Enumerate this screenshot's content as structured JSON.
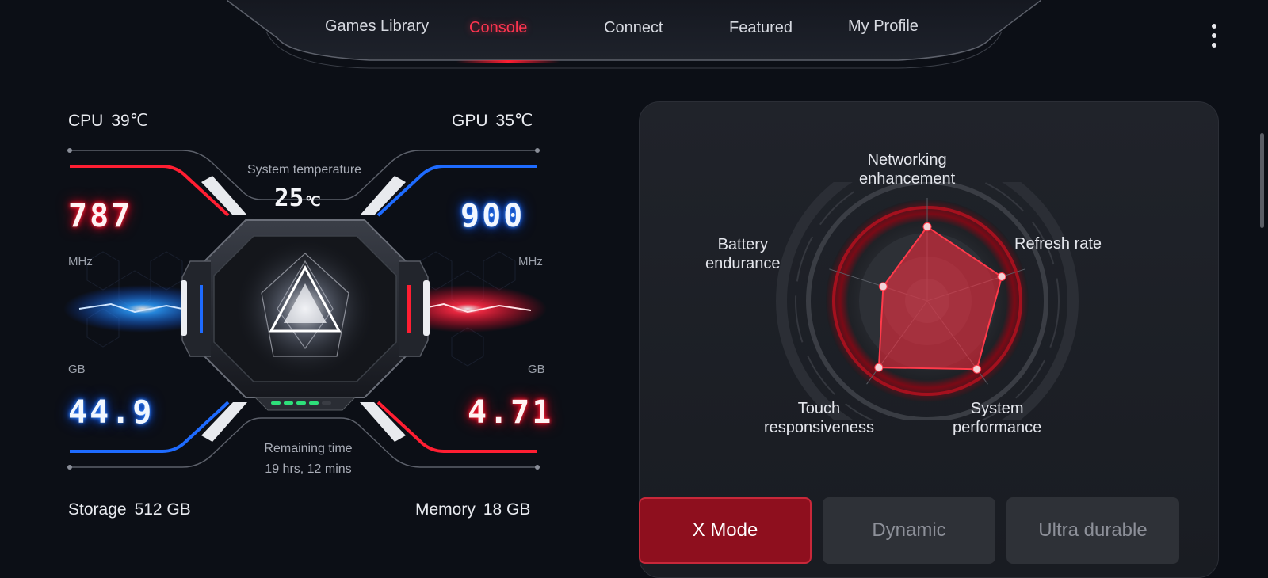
{
  "nav": {
    "tabs": [
      {
        "label": "Games Library",
        "active": false
      },
      {
        "label": "Console",
        "active": true
      },
      {
        "label": "Connect",
        "active": false
      },
      {
        "label": "Featured",
        "active": false
      },
      {
        "label": "My Profile",
        "active": false
      }
    ],
    "menu_icon": "more-vertical-icon"
  },
  "console": {
    "cpu": {
      "label": "CPU",
      "temp": "39℃",
      "freq": "787",
      "unit": "MHz"
    },
    "gpu": {
      "label": "GPU",
      "temp": "35℃",
      "freq": "900",
      "unit": "MHz"
    },
    "system_temperature": {
      "label": "System temperature",
      "value": "25",
      "unit": "℃"
    },
    "storage": {
      "label": "Storage",
      "total": "512 GB",
      "free": "44.9",
      "unit": "GB"
    },
    "memory": {
      "label": "Memory",
      "total": "18 GB",
      "used": "4.71",
      "unit": "GB"
    },
    "remaining_time": {
      "label": "Remaining time",
      "value": "19 hrs, 12 mins"
    },
    "battery_level": 0.8,
    "colors": {
      "red": "#ff1e32",
      "blue": "#1e6bff",
      "accent": "#ff3550"
    }
  },
  "performance": {
    "radar": [
      {
        "label_line1": "Networking",
        "label_line2": "enhancement",
        "level": 0.72
      },
      {
        "label_line1": "Refresh rate",
        "label_line2": "",
        "level": 0.76
      },
      {
        "label_line1": "System",
        "label_line2": "performance",
        "level": 0.82
      },
      {
        "label_line1": "Touch",
        "label_line2": "responsiveness",
        "level": 0.8
      },
      {
        "label_line1": "Battery",
        "label_line2": "endurance",
        "level": 0.45
      }
    ],
    "modes": [
      {
        "label": "X Mode",
        "active": true
      },
      {
        "label": "Dynamic",
        "active": false
      },
      {
        "label": "Ultra durable",
        "active": false
      }
    ]
  }
}
